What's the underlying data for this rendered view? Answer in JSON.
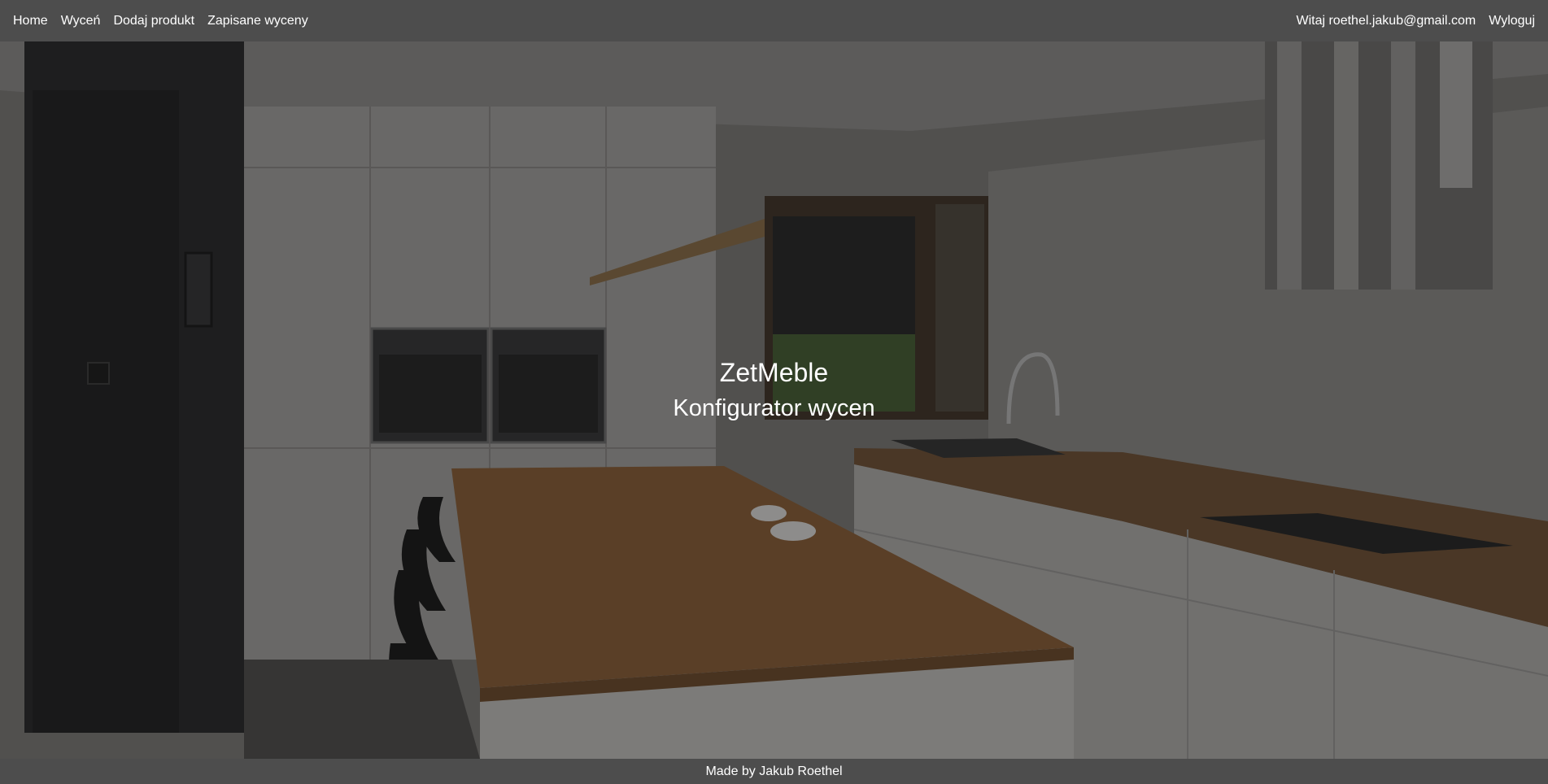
{
  "nav": {
    "home": "Home",
    "quote": "Wyceń",
    "add_product": "Dodaj produkt",
    "saved_quotes": "Zapisane wyceny",
    "welcome": "Witaj roethel.jakub@gmail.com",
    "logout": "Wyloguj"
  },
  "hero": {
    "title": "ZetMeble",
    "subtitle": "Konfigurator wycen"
  },
  "footer": {
    "text": "Made by Jakub Roethel"
  },
  "colors": {
    "navbar_bg": "#4d4d4d",
    "text": "#ffffff"
  }
}
